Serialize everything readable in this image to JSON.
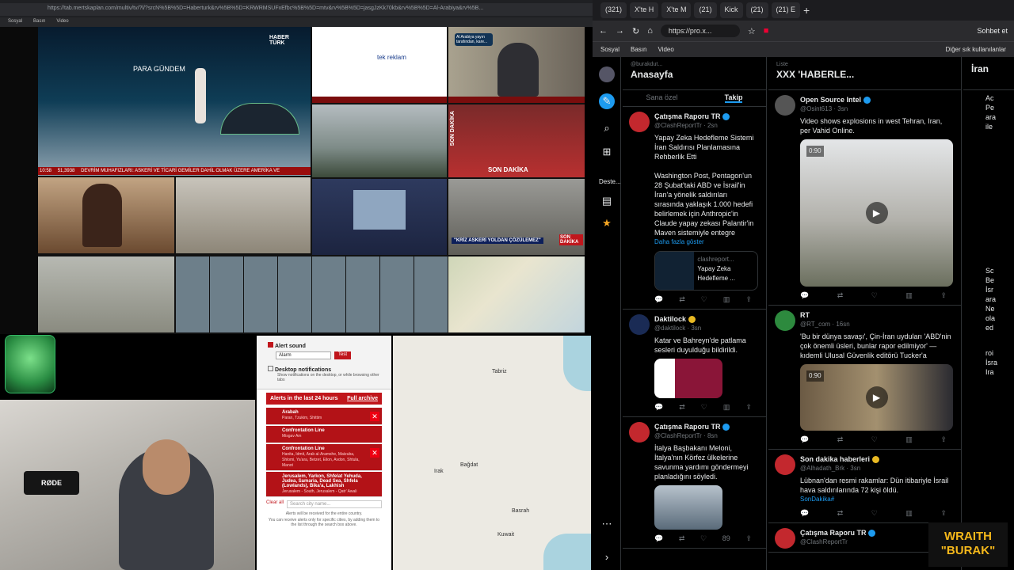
{
  "left_browser": {
    "url": "https://tab.mertskaplan.com/multiv/tv/?l/?srcN%5B%5D=Haberturk&rv%5B%5D=KRWRMSUFxEfbc%5B%5D=mtv&rv%5B%5D=jasgJzKk70kb&rv%5B%5D=Al-Arabiya&rv%5B...",
    "bookmarks": [
      "Sosyal",
      "Basın",
      "Video"
    ]
  },
  "tiles": {
    "haberturk_logo": "HABER TÜRK",
    "para_gundem": "PARA GÜNDEM",
    "ticker_time": "10:58",
    "ticker_value": "51,3938",
    "ticker": "DEVRİM MUHAFIZLARI: ASKERİ VE TİCARİ GEMİLER DAHİL OLMAK ÜZERE AMERİKA VE",
    "tek_reklam": "tek reklam",
    "son_dakika": "SON DAKİKA",
    "krize": "\"KRİZ ASKERİ YOLDAN ÇÖZÜLEMEZ\"",
    "son_dakika2": "SON DAKİKA",
    "arabiya_bubble": "Al Arabiya yayın tarafından, kare..."
  },
  "alert": {
    "sound_label": "Alert sound",
    "sound_select": "Alarm",
    "test_button": "Test",
    "desktop_label": "Desktop notifications",
    "desktop_desc": "Show notifications on the desktop, or while browsing other tabs",
    "last24": "Alerts in the last 24 hours",
    "archive": "Full archive",
    "items": [
      {
        "title": "Arabah",
        "sub": "Paran, Tzukim, Shittim"
      },
      {
        "title": "Confrontation Line",
        "sub": "Misgav Am"
      },
      {
        "title": "Confrontation Line",
        "sub": "Hanita, Idmit, Arab al-Aramshe, Matzuba, Shlomi, Ya'ara, Betzet, Eilon, Avdon, Shtula, Manot"
      },
      {
        "title": "Jerusalem, Yarkon, Shfelat Yehuda, Judea, Samaria, Dead Sea, Shfela (Lowlands), Bika'a, Lakhish",
        "sub": ""
      },
      {
        "title": "",
        "sub": "Jerusalem - South, Jerusalem - Qatr' Awali"
      }
    ],
    "clear": "Clear all",
    "search_placeholder": "Search city name...",
    "footer1": "Alerts will be received for the entire country.",
    "footer2": "You can receive alerts only for specific cities, by adding them to the list through the search box above."
  },
  "map_labels": {
    "tabriz": "Tabriz",
    "iraq": "Irak",
    "baghdad": "Bağdat",
    "basrah": "Basrah",
    "kuwait": "Kuwait"
  },
  "right_browser": {
    "tabs": [
      "(321)",
      "X'te H",
      "X'te M",
      "(21)",
      "Kick",
      "(21)",
      "(21) E"
    ],
    "url": "https://pro.x...",
    "chat": "Sohbet et",
    "bookmarks": [
      "Sosyal",
      "Basın",
      "Video"
    ],
    "other_bm": "Diğer sık kullanılanlar"
  },
  "deck": {
    "col1": {
      "user": "@burakdut...",
      "title": "Anasayfa",
      "tab1": "Sana özel",
      "tab2": "Takip"
    },
    "col2": {
      "sub": "Liste",
      "title": "XXX 'HABERLE..."
    },
    "col3_title": "İran",
    "nav_more": "Deste..."
  },
  "tweets_col1": [
    {
      "name": "Çatışma Raporu TR",
      "handle": "@ClashReportTr · 2sn",
      "text": "Yapay Zeka Hedefleme Sistemi İran Saldırısı Planlamasına Rehberlik Etti\n\nWashington Post, Pentagon'un 28 Şubat'taki ABD ve İsrail'in İran'a yönelik saldırıları sırasında yaklaşık 1.000 hedefi belirlemek için Anthropic'in Claude yapay zekası Palantir'in Maven sistemiyle entegre",
      "more": "Daha fazla göster",
      "card_site": "clashreport...",
      "card_title": "Yapay Zeka Hedefleme ..."
    },
    {
      "name": "Daktilock",
      "handle": "@daktilock · 3sn",
      "text": "Katar ve Bahreyn'de patlama sesleri duyulduğu bildirildi."
    },
    {
      "name": "Çatışma Raporu TR",
      "handle": "@ClashReportTr · 8sn",
      "text": "İtalya Başbakanı Meloni, İtalya'nın Körfez ülkelerine savunma yardımı göndermeyi planladığını söyledi."
    }
  ],
  "tweets_col2": [
    {
      "name": "Open Source Intel",
      "handle": "@Osint613 · 3sn",
      "text": "Video shows explosions in west Tehran, Iran, per Vahid Online.",
      "video_time": "0:90"
    },
    {
      "name": "RT",
      "handle": "@RT_com · 16sn",
      "text": "'Bu bir dünya savaşı', Çin-İran uyduları 'ABD'nin çok önemli üsleri, bunlar rapor edilmiyor' — kıdemli Ulusal Güvenlik editörü Tucker'a",
      "video_time": "0:90"
    },
    {
      "name": "Son dakika haberleri",
      "handle": "@Alhadath_Brk · 3sn",
      "text": "Lübnan'dan resmi rakamlar: Dün itibariyle İsrail hava saldırılarında 72 kişi öldü.",
      "tag": "SonDakika#"
    },
    {
      "name": "Çatışma Raporu TR",
      "handle": "@ClashReportTr",
      "text": ""
    }
  ],
  "stat": "89",
  "col3_items": [
    "Ac",
    "Pe",
    "ara",
    "ile",
    "Sc",
    "Be",
    "İsr",
    "ara",
    "Ne",
    "ola",
    "ed",
    "roi",
    "İsra",
    "Ira"
  ],
  "logo": "WRAITH\n\"BURAK\"",
  "mic": "RØDE"
}
